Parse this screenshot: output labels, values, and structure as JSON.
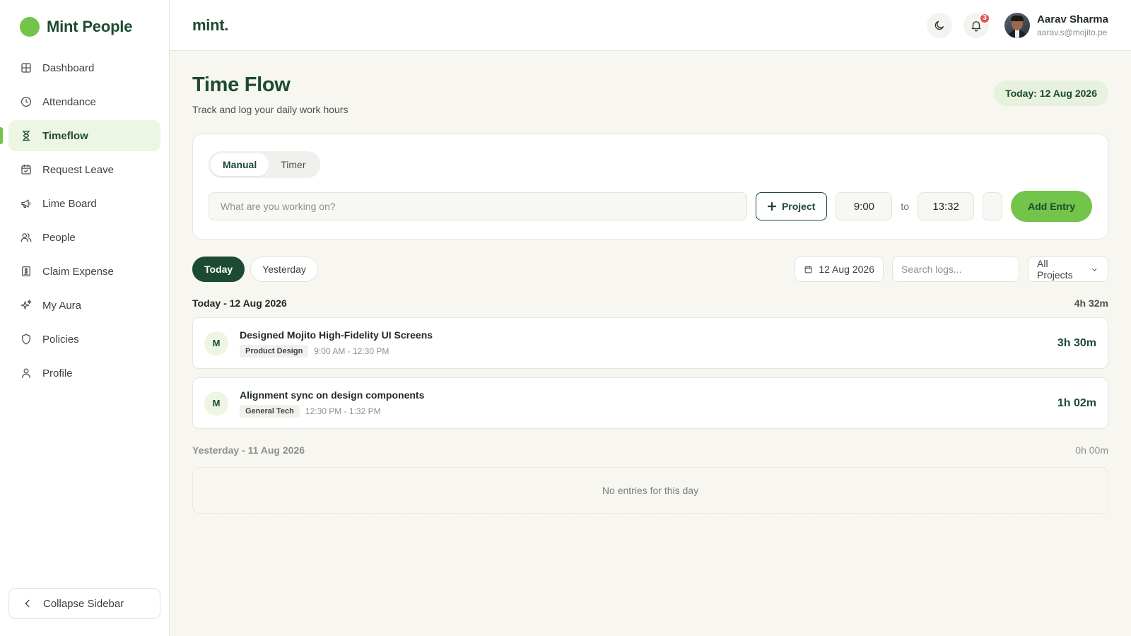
{
  "app": {
    "brand_name": "Mint People",
    "logo_text": "mint.",
    "accent": "#72c44a",
    "primary": "#1d4a33"
  },
  "sidebar": {
    "items": [
      {
        "label": "Dashboard",
        "icon": "grid-icon",
        "active": false
      },
      {
        "label": "Attendance",
        "icon": "clock-icon",
        "active": false
      },
      {
        "label": "Timeflow",
        "icon": "hourglass-icon",
        "active": true
      },
      {
        "label": "Request Leave",
        "icon": "calendar-check-icon",
        "active": false
      },
      {
        "label": "Lime Board",
        "icon": "megaphone-icon",
        "active": false
      },
      {
        "label": "People",
        "icon": "users-icon",
        "active": false
      },
      {
        "label": "Claim Expense",
        "icon": "receipt-icon",
        "active": false
      },
      {
        "label": "My Aura",
        "icon": "sparkles-icon",
        "active": false
      },
      {
        "label": "Policies",
        "icon": "shield-icon",
        "active": false
      },
      {
        "label": "Profile",
        "icon": "user-icon",
        "active": false
      }
    ],
    "collapse_label": "Collapse Sidebar"
  },
  "header": {
    "notification_count": "3",
    "user_name": "Aarav Sharma",
    "user_email": "aarav.s@mojito.pe"
  },
  "page": {
    "title": "Time Flow",
    "subtitle": "Track and log your daily work hours",
    "today_badge": "Today: 12 Aug 2026"
  },
  "entry": {
    "modes": [
      "Manual",
      "Timer"
    ],
    "active_mode": "Manual",
    "task_placeholder": "What are you working on?",
    "project_label": "Project",
    "start_time": "9:00",
    "to_label": "to",
    "end_time": "13:32",
    "add_label": "Add Entry"
  },
  "filters": {
    "tabs": [
      "Today",
      "Yesterday"
    ],
    "active_tab": "Today",
    "date": "12 Aug 2026",
    "search_placeholder": "Search logs...",
    "project_select": "All Projects"
  },
  "days": [
    {
      "label": "Today - 12 Aug 2026",
      "total": "4h 32m",
      "entries": [
        {
          "initial": "M",
          "title": "Designed Mojito High-Fidelity UI Screens",
          "tag": "Product Design",
          "range": "9:00 AM - 12:30 PM",
          "duration": "3h 30m"
        },
        {
          "initial": "M",
          "title": "Alignment sync on design components",
          "tag": "General Tech",
          "range": "12:30 PM - 1:32 PM",
          "duration": "1h 02m"
        }
      ]
    },
    {
      "label": "Yesterday - 11 Aug 2026",
      "total": "0h 00m",
      "entries": [],
      "empty_text": "No entries for this day"
    }
  ]
}
